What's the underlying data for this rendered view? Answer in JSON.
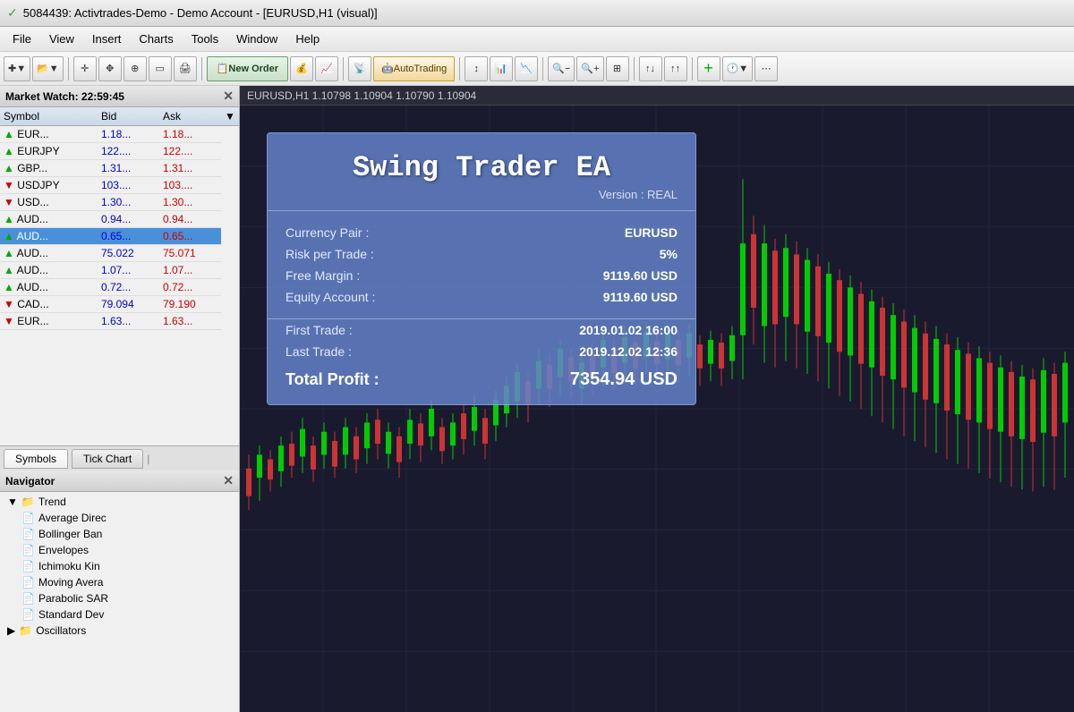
{
  "titleBar": {
    "icon": "✓",
    "text": "5084439: Activtrades-Demo - Demo Account - [EURUSD,H1 (visual)]"
  },
  "menuBar": {
    "items": [
      "File",
      "View",
      "Insert",
      "Charts",
      "Tools",
      "Window",
      "Help"
    ]
  },
  "toolbar": {
    "newOrderLabel": "New Order",
    "autoTradingLabel": "AutoTrading"
  },
  "marketWatch": {
    "title": "Market Watch: 22:59:45",
    "columns": [
      "Symbol",
      "Bid",
      "Ask"
    ],
    "symbols": [
      {
        "name": "EUR...",
        "direction": "up",
        "bid": "1.18...",
        "ask": "1.18..."
      },
      {
        "name": "EURJPY",
        "direction": "up",
        "bid": "122....",
        "ask": "122...."
      },
      {
        "name": "GBP...",
        "direction": "up",
        "bid": "1.31...",
        "ask": "1.31..."
      },
      {
        "name": "USDJPY",
        "direction": "down",
        "bid": "103....",
        "ask": "103...."
      },
      {
        "name": "USD...",
        "direction": "down",
        "bid": "1.30...",
        "ask": "1.30..."
      },
      {
        "name": "AUD...",
        "direction": "up",
        "bid": "0.94...",
        "ask": "0.94..."
      },
      {
        "name": "AUD...",
        "direction": "up",
        "bid": "0.65...",
        "ask": "0.65...",
        "selected": true
      },
      {
        "name": "AUD...",
        "direction": "up",
        "bid": "75.022",
        "ask": "75.071"
      },
      {
        "name": "AUD...",
        "direction": "up",
        "bid": "1.07...",
        "ask": "1.07..."
      },
      {
        "name": "AUD...",
        "direction": "up",
        "bid": "0.72...",
        "ask": "0.72..."
      },
      {
        "name": "CAD...",
        "direction": "down",
        "bid": "79.094",
        "ask": "79.190"
      },
      {
        "name": "EUR...",
        "direction": "down",
        "bid": "1.63...",
        "ask": "1.63..."
      }
    ],
    "tabs": [
      "Symbols",
      "Tick Chart"
    ],
    "activeTab": "Symbols"
  },
  "navigator": {
    "title": "Navigator",
    "tree": {
      "trend": {
        "label": "Trend",
        "children": [
          "Average Direc",
          "Bollinger Ban",
          "Envelopes",
          "Ichimoku Kin",
          "Moving Avera",
          "Parabolic SAR",
          "Standard Dev"
        ]
      },
      "oscillators": {
        "label": "Oscillators"
      }
    }
  },
  "chartHeader": {
    "text": "EURUSD,H1  1.10798  1.10904  1.10790  1.10904"
  },
  "eaPanel": {
    "title": "Swing Trader EA",
    "version": "Version : REAL",
    "rows": [
      {
        "label": "Currency Pair :",
        "value": "EURUSD"
      },
      {
        "label": "Risk per Trade :",
        "value": "5%"
      },
      {
        "label": "Free Margin :",
        "value": "9119.60 USD"
      },
      {
        "label": "Equity Account :",
        "value": "9119.60 USD"
      }
    ],
    "tradeRows": [
      {
        "label": "First Trade :",
        "value": "2019.01.02 16:00"
      },
      {
        "label": "Last Trade :",
        "value": "2019.12.02 12:36"
      }
    ],
    "profitLabel": "Total Profit :",
    "profitValue": "7354.94 USD"
  },
  "colors": {
    "bullCandle": "#00cc00",
    "bearCandle": "#cc0000",
    "background": "#1a1a2e",
    "gridLine": "#2a2a4a",
    "eaBackground": "rgba(100,130,200,0.85)"
  }
}
